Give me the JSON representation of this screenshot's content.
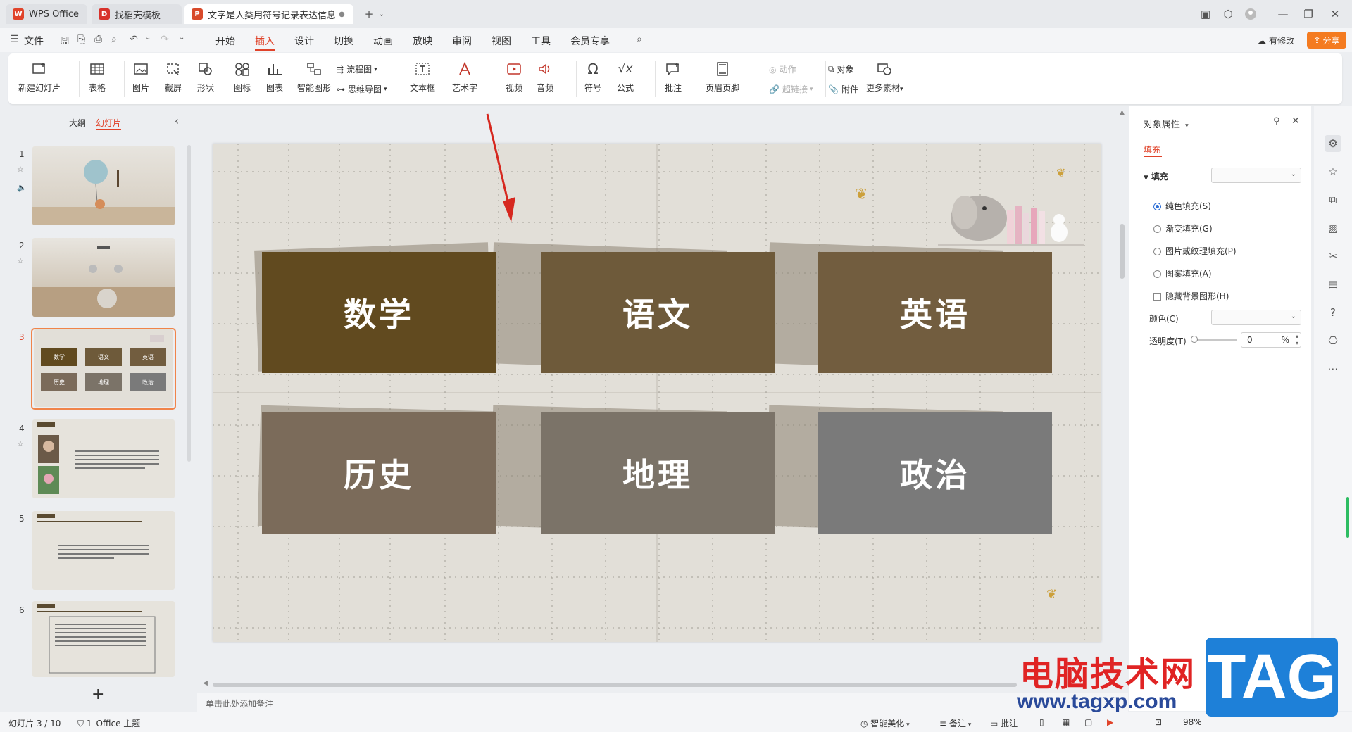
{
  "titlebar": {
    "tabs": [
      {
        "label": "WPS Office",
        "icon": "wps-logo-icon"
      },
      {
        "label": "找稻壳模板",
        "icon": "docer-icon"
      },
      {
        "label": "文字是人类用符号记录表达信息以",
        "icon": "ppt-icon"
      }
    ]
  },
  "menubar": {
    "file": "文件",
    "tabs": [
      "开始",
      "插入",
      "设计",
      "切换",
      "动画",
      "放映",
      "审阅",
      "视图",
      "工具",
      "会员专享"
    ],
    "active_tab": "插入",
    "revise": "有修改",
    "share": "分享"
  },
  "ribbon": {
    "new_slide": "新建幻灯片",
    "table": "表格",
    "picture": "图片",
    "screenshot": "截屏",
    "shape": "形状",
    "icon": "图标",
    "chart": "图表",
    "smartart": "智能图形",
    "flowchart": "流程图",
    "mindmap": "思维导图",
    "textbox": "文本框",
    "wordart": "艺术字",
    "video": "视频",
    "audio": "音频",
    "symbol": "符号",
    "formula": "公式",
    "comment": "批注",
    "header_footer": "页眉页脚",
    "action": "动作",
    "hyperlink": "超链接",
    "object": "对象",
    "attachment": "附件",
    "more": "更多素材"
  },
  "leftpanel": {
    "outline_tab": "大纲",
    "slides_tab": "幻灯片",
    "slide_numbers": [
      "1",
      "2",
      "3",
      "4",
      "5",
      "6"
    ],
    "add": "+"
  },
  "slide": {
    "cards": [
      {
        "label": "数学",
        "color": "#614a1f"
      },
      {
        "label": "语文",
        "color": "#6e5a3a"
      },
      {
        "label": "英语",
        "color": "#725d3f"
      },
      {
        "label": "历史",
        "color": "#7b6b5a"
      },
      {
        "label": "地理",
        "color": "#7b7368"
      },
      {
        "label": "政治",
        "color": "#7a7a7a"
      }
    ]
  },
  "notes_placeholder": "单击此处添加备注",
  "rightpanel": {
    "title": "对象属性",
    "tab_fill": "填充",
    "section": "填充",
    "options": [
      {
        "label": "纯色填充(S)",
        "type": "radio",
        "checked": true
      },
      {
        "label": "渐变填充(G)",
        "type": "radio",
        "checked": false
      },
      {
        "label": "图片或纹理填充(P)",
        "type": "radio",
        "checked": false
      },
      {
        "label": "图案填充(A)",
        "type": "radio",
        "checked": false
      },
      {
        "label": "隐藏背景图形(H)",
        "type": "checkbox",
        "checked": false
      }
    ],
    "color_label": "颜色(C)",
    "transparency_label": "透明度(T)",
    "transparency_value": "0",
    "transparency_unit": "%"
  },
  "statusbar": {
    "slide_info": "幻灯片 3 / 10",
    "theme": "1_Office 主题",
    "smart_beautify": "智能美化",
    "notes": "备注",
    "comments": "批注",
    "zoom": "98%"
  },
  "watermark": {
    "title": "电脑技术网",
    "url": "www.tagxp.com",
    "badge": "TAG"
  },
  "colors": {
    "accent": "#e0432a",
    "share_bg": "#f47b20"
  }
}
